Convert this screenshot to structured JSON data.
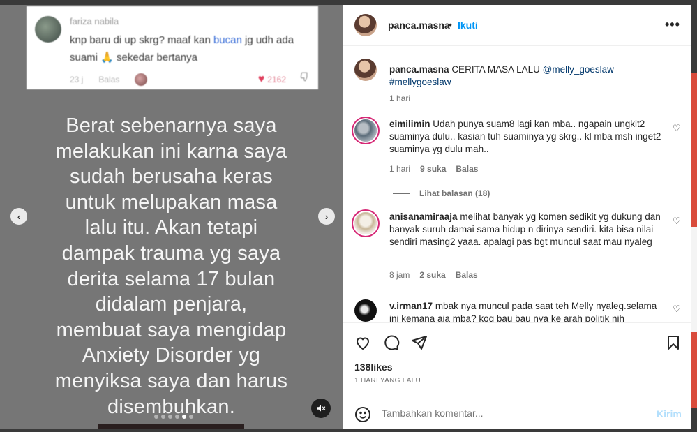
{
  "media": {
    "embedded_comment": {
      "username": "fariza nabila",
      "text_before_link": "knp baru di up skrg? maaf kan ",
      "link": "bucan",
      "text_after_link": " jg udh ada suami 🙏 sekedar bertanya",
      "age": "23 j",
      "reply_label": "Balas",
      "like_count": "2162"
    },
    "overlay_lines": [
      "Berat sebenarnya saya",
      "melakukan ini karna saya",
      "sudah berusaha keras",
      "untuk melupakan masa",
      "lalu itu. Akan tetapi",
      "dampak trauma yg saya",
      "derita selama 17 bulan",
      "didalam penjara,",
      "membuat saya mengidap",
      "Anxiety Disorder yg",
      "menyiksa saya dan harus",
      "disembuhkan."
    ],
    "carousel_total": 6,
    "carousel_active_index": 4
  },
  "header": {
    "username": "panca.masna",
    "separator": "•",
    "follow_label": "Ikuti",
    "more_label": "•••"
  },
  "caption": {
    "username": "panca.masna",
    "text": "CERITA MASA LALU",
    "mention": "@melly_goeslaw",
    "hashtag": "#mellygoeslaw",
    "age": "1 hari"
  },
  "comments": [
    {
      "username": "eimilimin",
      "text": "Udah punya suam8 lagi kan mba.. ngapain ungkit2 suaminya dulu.. kasian tuh suaminya yg skrg.. kl mba msh inget2 suaminya yg dulu mah..",
      "age": "1 hari",
      "likes": "9 suka",
      "reply_label": "Balas",
      "view_replies": "Lihat balasan (18)"
    },
    {
      "username": "anisanamiraaja",
      "text": "melihat banyak yg komen sedikit yg dukung dan banyak suruh damai sama hidup n dirinya sendiri. kita bisa nilai sendiri masing2 yaaa. apalagi pas bgt muncul saat mau nyaleg",
      "age": "8 jam",
      "likes": "2 suka",
      "reply_label": "Balas"
    },
    {
      "username": "v.irman17",
      "text": "mbak nya muncul pada saat teh Melly nyaleg.selama ini kemana aja mba? koq bau bau nya ke arah politik nih"
    }
  ],
  "footer": {
    "likes": "138likes",
    "posted": "1 HARI YANG LALU",
    "comment_placeholder": "Tambahkan komentar...",
    "post_label": "Kirim"
  }
}
